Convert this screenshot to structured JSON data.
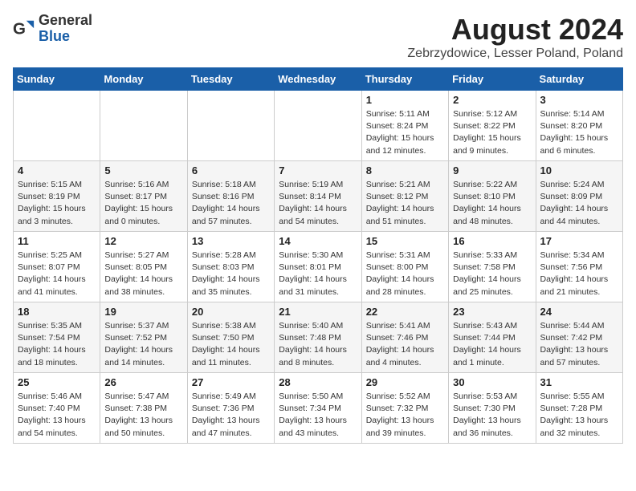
{
  "header": {
    "logo_general": "General",
    "logo_blue": "Blue",
    "month_title": "August 2024",
    "location": "Zebrzydowice, Lesser Poland, Poland"
  },
  "days_of_week": [
    "Sunday",
    "Monday",
    "Tuesday",
    "Wednesday",
    "Thursday",
    "Friday",
    "Saturday"
  ],
  "weeks": [
    [
      {
        "day": "",
        "info": ""
      },
      {
        "day": "",
        "info": ""
      },
      {
        "day": "",
        "info": ""
      },
      {
        "day": "",
        "info": ""
      },
      {
        "day": "1",
        "info": "Sunrise: 5:11 AM\nSunset: 8:24 PM\nDaylight: 15 hours\nand 12 minutes."
      },
      {
        "day": "2",
        "info": "Sunrise: 5:12 AM\nSunset: 8:22 PM\nDaylight: 15 hours\nand 9 minutes."
      },
      {
        "day": "3",
        "info": "Sunrise: 5:14 AM\nSunset: 8:20 PM\nDaylight: 15 hours\nand 6 minutes."
      }
    ],
    [
      {
        "day": "4",
        "info": "Sunrise: 5:15 AM\nSunset: 8:19 PM\nDaylight: 15 hours\nand 3 minutes."
      },
      {
        "day": "5",
        "info": "Sunrise: 5:16 AM\nSunset: 8:17 PM\nDaylight: 15 hours\nand 0 minutes."
      },
      {
        "day": "6",
        "info": "Sunrise: 5:18 AM\nSunset: 8:16 PM\nDaylight: 14 hours\nand 57 minutes."
      },
      {
        "day": "7",
        "info": "Sunrise: 5:19 AM\nSunset: 8:14 PM\nDaylight: 14 hours\nand 54 minutes."
      },
      {
        "day": "8",
        "info": "Sunrise: 5:21 AM\nSunset: 8:12 PM\nDaylight: 14 hours\nand 51 minutes."
      },
      {
        "day": "9",
        "info": "Sunrise: 5:22 AM\nSunset: 8:10 PM\nDaylight: 14 hours\nand 48 minutes."
      },
      {
        "day": "10",
        "info": "Sunrise: 5:24 AM\nSunset: 8:09 PM\nDaylight: 14 hours\nand 44 minutes."
      }
    ],
    [
      {
        "day": "11",
        "info": "Sunrise: 5:25 AM\nSunset: 8:07 PM\nDaylight: 14 hours\nand 41 minutes."
      },
      {
        "day": "12",
        "info": "Sunrise: 5:27 AM\nSunset: 8:05 PM\nDaylight: 14 hours\nand 38 minutes."
      },
      {
        "day": "13",
        "info": "Sunrise: 5:28 AM\nSunset: 8:03 PM\nDaylight: 14 hours\nand 35 minutes."
      },
      {
        "day": "14",
        "info": "Sunrise: 5:30 AM\nSunset: 8:01 PM\nDaylight: 14 hours\nand 31 minutes."
      },
      {
        "day": "15",
        "info": "Sunrise: 5:31 AM\nSunset: 8:00 PM\nDaylight: 14 hours\nand 28 minutes."
      },
      {
        "day": "16",
        "info": "Sunrise: 5:33 AM\nSunset: 7:58 PM\nDaylight: 14 hours\nand 25 minutes."
      },
      {
        "day": "17",
        "info": "Sunrise: 5:34 AM\nSunset: 7:56 PM\nDaylight: 14 hours\nand 21 minutes."
      }
    ],
    [
      {
        "day": "18",
        "info": "Sunrise: 5:35 AM\nSunset: 7:54 PM\nDaylight: 14 hours\nand 18 minutes."
      },
      {
        "day": "19",
        "info": "Sunrise: 5:37 AM\nSunset: 7:52 PM\nDaylight: 14 hours\nand 14 minutes."
      },
      {
        "day": "20",
        "info": "Sunrise: 5:38 AM\nSunset: 7:50 PM\nDaylight: 14 hours\nand 11 minutes."
      },
      {
        "day": "21",
        "info": "Sunrise: 5:40 AM\nSunset: 7:48 PM\nDaylight: 14 hours\nand 8 minutes."
      },
      {
        "day": "22",
        "info": "Sunrise: 5:41 AM\nSunset: 7:46 PM\nDaylight: 14 hours\nand 4 minutes."
      },
      {
        "day": "23",
        "info": "Sunrise: 5:43 AM\nSunset: 7:44 PM\nDaylight: 14 hours\nand 1 minute."
      },
      {
        "day": "24",
        "info": "Sunrise: 5:44 AM\nSunset: 7:42 PM\nDaylight: 13 hours\nand 57 minutes."
      }
    ],
    [
      {
        "day": "25",
        "info": "Sunrise: 5:46 AM\nSunset: 7:40 PM\nDaylight: 13 hours\nand 54 minutes."
      },
      {
        "day": "26",
        "info": "Sunrise: 5:47 AM\nSunset: 7:38 PM\nDaylight: 13 hours\nand 50 minutes."
      },
      {
        "day": "27",
        "info": "Sunrise: 5:49 AM\nSunset: 7:36 PM\nDaylight: 13 hours\nand 47 minutes."
      },
      {
        "day": "28",
        "info": "Sunrise: 5:50 AM\nSunset: 7:34 PM\nDaylight: 13 hours\nand 43 minutes."
      },
      {
        "day": "29",
        "info": "Sunrise: 5:52 AM\nSunset: 7:32 PM\nDaylight: 13 hours\nand 39 minutes."
      },
      {
        "day": "30",
        "info": "Sunrise: 5:53 AM\nSunset: 7:30 PM\nDaylight: 13 hours\nand 36 minutes."
      },
      {
        "day": "31",
        "info": "Sunrise: 5:55 AM\nSunset: 7:28 PM\nDaylight: 13 hours\nand 32 minutes."
      }
    ]
  ]
}
